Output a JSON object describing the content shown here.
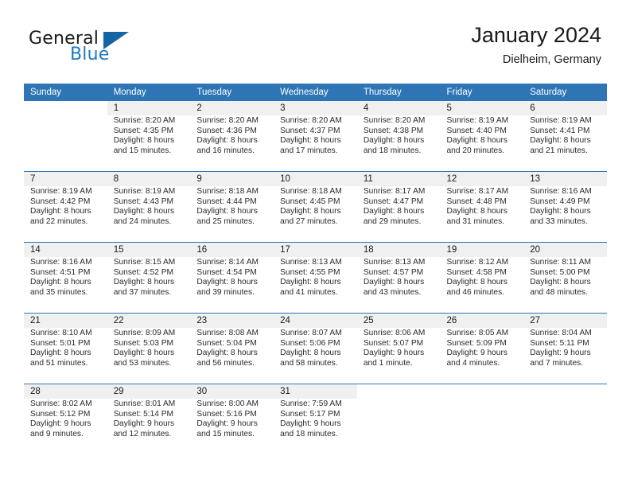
{
  "brand": {
    "name_part1": "General",
    "name_part2": "Blue",
    "mark": "triangle-logo"
  },
  "header": {
    "title": "January 2024",
    "location": "Dielheim, Germany"
  },
  "colors": {
    "header_blue": "#2e75b6",
    "brand_blue": "#2079c4",
    "daynum_bg": "#f0f0f0",
    "text": "#1a1a1a"
  },
  "weekdays": [
    "Sunday",
    "Monday",
    "Tuesday",
    "Wednesday",
    "Thursday",
    "Friday",
    "Saturday"
  ],
  "weeks": [
    {
      "days": [
        {
          "num": "",
          "sunrise": "",
          "sunset": "",
          "daylight1": "",
          "daylight2": ""
        },
        {
          "num": "1",
          "sunrise": "Sunrise: 8:20 AM",
          "sunset": "Sunset: 4:35 PM",
          "daylight1": "Daylight: 8 hours",
          "daylight2": "and 15 minutes."
        },
        {
          "num": "2",
          "sunrise": "Sunrise: 8:20 AM",
          "sunset": "Sunset: 4:36 PM",
          "daylight1": "Daylight: 8 hours",
          "daylight2": "and 16 minutes."
        },
        {
          "num": "3",
          "sunrise": "Sunrise: 8:20 AM",
          "sunset": "Sunset: 4:37 PM",
          "daylight1": "Daylight: 8 hours",
          "daylight2": "and 17 minutes."
        },
        {
          "num": "4",
          "sunrise": "Sunrise: 8:20 AM",
          "sunset": "Sunset: 4:38 PM",
          "daylight1": "Daylight: 8 hours",
          "daylight2": "and 18 minutes."
        },
        {
          "num": "5",
          "sunrise": "Sunrise: 8:19 AM",
          "sunset": "Sunset: 4:40 PM",
          "daylight1": "Daylight: 8 hours",
          "daylight2": "and 20 minutes."
        },
        {
          "num": "6",
          "sunrise": "Sunrise: 8:19 AM",
          "sunset": "Sunset: 4:41 PM",
          "daylight1": "Daylight: 8 hours",
          "daylight2": "and 21 minutes."
        }
      ]
    },
    {
      "days": [
        {
          "num": "7",
          "sunrise": "Sunrise: 8:19 AM",
          "sunset": "Sunset: 4:42 PM",
          "daylight1": "Daylight: 8 hours",
          "daylight2": "and 22 minutes."
        },
        {
          "num": "8",
          "sunrise": "Sunrise: 8:19 AM",
          "sunset": "Sunset: 4:43 PM",
          "daylight1": "Daylight: 8 hours",
          "daylight2": "and 24 minutes."
        },
        {
          "num": "9",
          "sunrise": "Sunrise: 8:18 AM",
          "sunset": "Sunset: 4:44 PM",
          "daylight1": "Daylight: 8 hours",
          "daylight2": "and 25 minutes."
        },
        {
          "num": "10",
          "sunrise": "Sunrise: 8:18 AM",
          "sunset": "Sunset: 4:45 PM",
          "daylight1": "Daylight: 8 hours",
          "daylight2": "and 27 minutes."
        },
        {
          "num": "11",
          "sunrise": "Sunrise: 8:17 AM",
          "sunset": "Sunset: 4:47 PM",
          "daylight1": "Daylight: 8 hours",
          "daylight2": "and 29 minutes."
        },
        {
          "num": "12",
          "sunrise": "Sunrise: 8:17 AM",
          "sunset": "Sunset: 4:48 PM",
          "daylight1": "Daylight: 8 hours",
          "daylight2": "and 31 minutes."
        },
        {
          "num": "13",
          "sunrise": "Sunrise: 8:16 AM",
          "sunset": "Sunset: 4:49 PM",
          "daylight1": "Daylight: 8 hours",
          "daylight2": "and 33 minutes."
        }
      ]
    },
    {
      "days": [
        {
          "num": "14",
          "sunrise": "Sunrise: 8:16 AM",
          "sunset": "Sunset: 4:51 PM",
          "daylight1": "Daylight: 8 hours",
          "daylight2": "and 35 minutes."
        },
        {
          "num": "15",
          "sunrise": "Sunrise: 8:15 AM",
          "sunset": "Sunset: 4:52 PM",
          "daylight1": "Daylight: 8 hours",
          "daylight2": "and 37 minutes."
        },
        {
          "num": "16",
          "sunrise": "Sunrise: 8:14 AM",
          "sunset": "Sunset: 4:54 PM",
          "daylight1": "Daylight: 8 hours",
          "daylight2": "and 39 minutes."
        },
        {
          "num": "17",
          "sunrise": "Sunrise: 8:13 AM",
          "sunset": "Sunset: 4:55 PM",
          "daylight1": "Daylight: 8 hours",
          "daylight2": "and 41 minutes."
        },
        {
          "num": "18",
          "sunrise": "Sunrise: 8:13 AM",
          "sunset": "Sunset: 4:57 PM",
          "daylight1": "Daylight: 8 hours",
          "daylight2": "and 43 minutes."
        },
        {
          "num": "19",
          "sunrise": "Sunrise: 8:12 AM",
          "sunset": "Sunset: 4:58 PM",
          "daylight1": "Daylight: 8 hours",
          "daylight2": "and 46 minutes."
        },
        {
          "num": "20",
          "sunrise": "Sunrise: 8:11 AM",
          "sunset": "Sunset: 5:00 PM",
          "daylight1": "Daylight: 8 hours",
          "daylight2": "and 48 minutes."
        }
      ]
    },
    {
      "days": [
        {
          "num": "21",
          "sunrise": "Sunrise: 8:10 AM",
          "sunset": "Sunset: 5:01 PM",
          "daylight1": "Daylight: 8 hours",
          "daylight2": "and 51 minutes."
        },
        {
          "num": "22",
          "sunrise": "Sunrise: 8:09 AM",
          "sunset": "Sunset: 5:03 PM",
          "daylight1": "Daylight: 8 hours",
          "daylight2": "and 53 minutes."
        },
        {
          "num": "23",
          "sunrise": "Sunrise: 8:08 AM",
          "sunset": "Sunset: 5:04 PM",
          "daylight1": "Daylight: 8 hours",
          "daylight2": "and 56 minutes."
        },
        {
          "num": "24",
          "sunrise": "Sunrise: 8:07 AM",
          "sunset": "Sunset: 5:06 PM",
          "daylight1": "Daylight: 8 hours",
          "daylight2": "and 58 minutes."
        },
        {
          "num": "25",
          "sunrise": "Sunrise: 8:06 AM",
          "sunset": "Sunset: 5:07 PM",
          "daylight1": "Daylight: 9 hours",
          "daylight2": "and 1 minute."
        },
        {
          "num": "26",
          "sunrise": "Sunrise: 8:05 AM",
          "sunset": "Sunset: 5:09 PM",
          "daylight1": "Daylight: 9 hours",
          "daylight2": "and 4 minutes."
        },
        {
          "num": "27",
          "sunrise": "Sunrise: 8:04 AM",
          "sunset": "Sunset: 5:11 PM",
          "daylight1": "Daylight: 9 hours",
          "daylight2": "and 7 minutes."
        }
      ]
    },
    {
      "days": [
        {
          "num": "28",
          "sunrise": "Sunrise: 8:02 AM",
          "sunset": "Sunset: 5:12 PM",
          "daylight1": "Daylight: 9 hours",
          "daylight2": "and 9 minutes."
        },
        {
          "num": "29",
          "sunrise": "Sunrise: 8:01 AM",
          "sunset": "Sunset: 5:14 PM",
          "daylight1": "Daylight: 9 hours",
          "daylight2": "and 12 minutes."
        },
        {
          "num": "30",
          "sunrise": "Sunrise: 8:00 AM",
          "sunset": "Sunset: 5:16 PM",
          "daylight1": "Daylight: 9 hours",
          "daylight2": "and 15 minutes."
        },
        {
          "num": "31",
          "sunrise": "Sunrise: 7:59 AM",
          "sunset": "Sunset: 5:17 PM",
          "daylight1": "Daylight: 9 hours",
          "daylight2": "and 18 minutes."
        },
        {
          "num": "",
          "sunrise": "",
          "sunset": "",
          "daylight1": "",
          "daylight2": ""
        },
        {
          "num": "",
          "sunrise": "",
          "sunset": "",
          "daylight1": "",
          "daylight2": ""
        },
        {
          "num": "",
          "sunrise": "",
          "sunset": "",
          "daylight1": "",
          "daylight2": ""
        }
      ]
    }
  ]
}
